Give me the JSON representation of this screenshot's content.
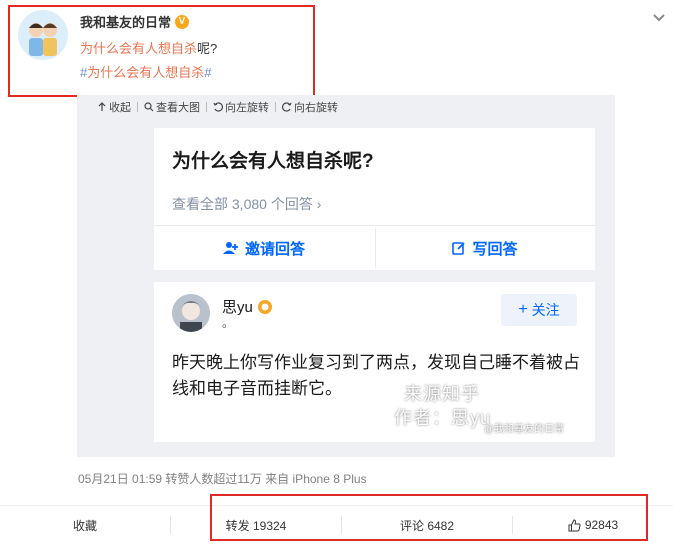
{
  "post": {
    "username": "我和基友的日常",
    "line1_link": "为什么会有人想自杀",
    "line1_rest": "呢?",
    "hashtag_text": "为什么会有人想自杀",
    "hash_symbol": "#",
    "verified_icon": "V"
  },
  "toolbar": {
    "collapse": "收起",
    "view_large": "查看大图",
    "rotate_left": "向左旋转",
    "rotate_right": "向右旋转"
  },
  "zhihu": {
    "question_title": "为什么会有人想自杀呢?",
    "view_all": "查看全部 3,080 个回答",
    "invite_answer": "邀请回答",
    "write_answer": "写回答",
    "answerer_name": "思yu",
    "answerer_dot": "。",
    "follow": "关注",
    "answer_text": "昨天晚上你写作业复习到了两点，发现自己睡不着被占线和电子音而挂断它。",
    "watermark_source": "来源知乎",
    "watermark_author": "作者：思yu",
    "watermark_weibo": "@我和基友的日常"
  },
  "meta": {
    "info": "05月21日 01:59 转赞人数超过11万  来自 iPhone 8 Plus"
  },
  "actions": {
    "favorite": "收藏",
    "repost": "转发 19324",
    "comment": "评论 6482",
    "like": "92843"
  },
  "colors": {
    "link_orange": "#eb7350",
    "hash_blue": "#6b8fd3",
    "zhihu_blue": "#0066ff",
    "highlight_red": "#e12a26"
  }
}
